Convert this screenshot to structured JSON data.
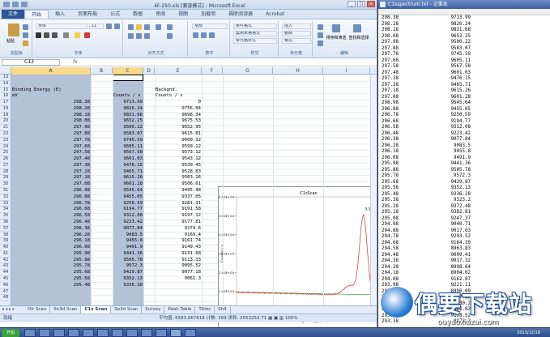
{
  "excel": {
    "title": "4F-250.xls  [兼容模式]  -  Microsoft Excel",
    "tabs": [
      "文件",
      "开始",
      "插入",
      "页面布局",
      "公式",
      "数据",
      "审阅",
      "视图",
      "加载项",
      "福昕阅读器",
      "Acrobat"
    ],
    "active_tab": "开始",
    "ribbon": {
      "paste": "粘贴",
      "clipboard": "剪贴板",
      "font_name": "宋体",
      "font_size": "11",
      "font_group": "字体",
      "align_group": "对齐方式",
      "number_format": "常规",
      "number_group": "数字",
      "cond_format": "条件格式",
      "table_format": "套用表格格式",
      "cell_style": "单元格样式",
      "style_group": "样式",
      "insert": "插入",
      "delete": "删除",
      "format": "格式",
      "cells_group": "单元格",
      "sort_filter": "排序和筛选",
      "find_select": "查找和选择",
      "edit_group": "编辑"
    },
    "name_box": "C13",
    "fx": "fx",
    "columns": [
      "A",
      "B",
      "C",
      "D",
      "E",
      "F",
      "G",
      "H",
      "I"
    ],
    "rows": [
      "13",
      "14",
      "15",
      "16",
      "17",
      "18",
      "19",
      "20",
      "21",
      "22",
      "23",
      "24",
      "25",
      "26",
      "27",
      "28",
      "29",
      "30",
      "31",
      "32",
      "33",
      "34",
      "35",
      "36",
      "37",
      "38",
      "39",
      "40",
      "41",
      "42",
      "43",
      "44",
      "45",
      "46",
      "47",
      "48"
    ],
    "header_a1": "Binding Energy (E)",
    "header_a2": "eV",
    "header_c": "Counts / s",
    "header_e1": "Backgnd.",
    "header_e2": "Counts / s",
    "header_e3": "0",
    "col_a": [
      "298.38",
      "298.28",
      "298.18",
      "298.08",
      "297.98",
      "297.88",
      "297.78",
      "297.68",
      "297.58",
      "297.48",
      "297.38",
      "297.28",
      "297.18",
      "297.08",
      "296.98",
      "296.88",
      "296.78",
      "296.68",
      "296.58",
      "296.48",
      "296.38",
      "296.28",
      "296.18",
      "296.08",
      "295.98",
      "295.88",
      "295.78",
      "295.68",
      "295.58",
      "295.48"
    ],
    "col_c": [
      "9713.99",
      "9826.24",
      "9831.68",
      "9652.25",
      "9500.22",
      "9583.07",
      "9745.59",
      "9605.11",
      "9567.58",
      "9601.03",
      "9476.15",
      "9465.71",
      "9615.26",
      "9601.28",
      "9545.64",
      "9455.05",
      "9250.59",
      "9194.77",
      "9312.08",
      "9223.42",
      "9077.84",
      "9083.5",
      "9455.8",
      "9491.9",
      "9441.36",
      "9505.78",
      "9572.3",
      "9429.87",
      "9352.13",
      "9336.28"
    ],
    "col_e": [
      "9756.04",
      "9698.34",
      "9675.53",
      "9652.95",
      "9615.81",
      "9600.32",
      "9599.12",
      "9573.12",
      "9543.12",
      "9539.45",
      "9528.83",
      "9503.16",
      "9506.61",
      "9495.48",
      "9337.05",
      "9281.31",
      "9191.58",
      "9197.12",
      "9177.81",
      "9174.6",
      "9169.4",
      "9161.74",
      "9149.43",
      "9131.68",
      "9113.33",
      "9095.52",
      "9077.18",
      "9061.3"
    ],
    "chart": {
      "title": "C1sScan",
      "ylabel": "Counts / s",
      "xlabel": "Binding Energy (eV)",
      "y_ticks": [
        "0.00E+00",
        "1.00E+04",
        "2.00E+04",
        "3.00E+04",
        "4.00E+04",
        "5.00E+04",
        "6.00E+04"
      ],
      "x_ticks": [
        "298",
        "297",
        "296",
        "295",
        "294",
        "293",
        "292",
        "291",
        "290",
        "289",
        "288",
        "287",
        "286",
        "285",
        "284",
        "283"
      ],
      "peak_label": "5.3E"
    },
    "sheets": [
      "Olr Scan",
      "Sn3d Scan",
      "C1s Scan",
      "Se3d Scan",
      "Survey",
      "Peak Table",
      "Titles",
      "Sh4"
    ],
    "active_sheet": "C1s Scan",
    "status_left": "就绪",
    "status_right": "平均值: 6583.067618   计数: 269   求和: 2553252.71   ▦ ▣ ▥  100%"
  },
  "notepad": {
    "title": "C1sspectrum.txt - 记事本",
    "left": [
      "298.38",
      "298.28",
      "298.18",
      "298.08",
      "297.98",
      "297.88",
      "297.78",
      "297.68",
      "297.58",
      "297.48",
      "297.38",
      "297.28",
      "297.18",
      "297.08",
      "296.98",
      "296.88",
      "296.78",
      "296.68",
      "296.58",
      "296.48",
      "296.38",
      "296.28",
      "296.18",
      "296.08",
      "295.98",
      "295.88",
      "295.78",
      "295.68",
      "295.58",
      "295.48",
      "295.38",
      "295.28",
      "295.18",
      "295.08",
      "294.98",
      "294.88",
      "294.78",
      "294.68",
      "294.58",
      "294.48",
      "294.38",
      "294.28",
      "294.18",
      "294.08",
      "293.98",
      "293.88",
      "293.78",
      "293.68",
      "293.58",
      "293.48",
      "293.38"
    ],
    "right": [
      "9713.99",
      "9826.24",
      "9831.68",
      "9652.25",
      "9500.22",
      "9583.07",
      "9745.59",
      "9605.11",
      "9567.58",
      "9601.03",
      "9476.15",
      "9465.71",
      "9615.26",
      "9601.28",
      "9545.64",
      "9455.05",
      "9250.59",
      "9194.77",
      "9312.08",
      "9223.42",
      "9077.84",
      "9083.5",
      "9455.8",
      "9491.9",
      "9441.36",
      "9505.78",
      "9572.3",
      "9429.87",
      "9352.13",
      "9336.28",
      "9323.2",
      "9372.48",
      "9382.81",
      "9247.37",
      "9040.71",
      "9017.63",
      "9203.52",
      "9164.39",
      "8963.83",
      "9009.41",
      "9017.32",
      "8998.64",
      "8904.02",
      "9162.87",
      "9221.11",
      "8990.09",
      "9137.17",
      "9030.2",
      "9101.82",
      "9173.52",
      "8973.3"
    ]
  },
  "watermark": {
    "text": "偶要下载站",
    "url": "ouyaoxiazai.com"
  },
  "taskbar": {
    "start": "开始",
    "clock": "2013/12/18"
  }
}
